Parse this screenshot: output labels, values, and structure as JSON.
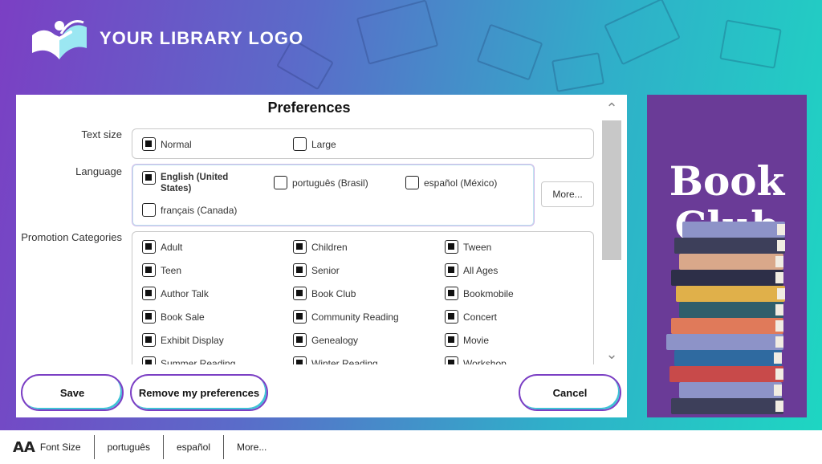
{
  "logo": {
    "text": "YOUR LIBRARY LOGO"
  },
  "dialog": {
    "title": "Preferences",
    "text_size": {
      "label": "Text size",
      "options": [
        {
          "label": "Normal",
          "checked": true
        },
        {
          "label": "Large",
          "checked": false
        }
      ]
    },
    "language": {
      "label": "Language",
      "options": [
        {
          "label": "English (United States)",
          "checked": true
        },
        {
          "label": "português (Brasil)",
          "checked": false
        },
        {
          "label": "español (México)",
          "checked": false
        },
        {
          "label": "français (Canada)",
          "checked": false
        }
      ],
      "more_label": "More..."
    },
    "promotion": {
      "label": "Promotion Categories",
      "options": [
        {
          "label": "Adult",
          "checked": true
        },
        {
          "label": "Children",
          "checked": true
        },
        {
          "label": "Tween",
          "checked": true
        },
        {
          "label": "Teen",
          "checked": true
        },
        {
          "label": "Senior",
          "checked": true
        },
        {
          "label": "All Ages",
          "checked": true
        },
        {
          "label": "Author Talk",
          "checked": true
        },
        {
          "label": "Book Club",
          "checked": true
        },
        {
          "label": "Bookmobile",
          "checked": true
        },
        {
          "label": "Book Sale",
          "checked": true
        },
        {
          "label": "Community Reading",
          "checked": true
        },
        {
          "label": "Concert",
          "checked": true
        },
        {
          "label": "Exhibit Display",
          "checked": true
        },
        {
          "label": "Genealogy",
          "checked": true
        },
        {
          "label": "Movie",
          "checked": true
        },
        {
          "label": "Summer Reading",
          "checked": true
        },
        {
          "label": "Winter Reading",
          "checked": true
        },
        {
          "label": "Workshop",
          "checked": true
        }
      ]
    },
    "buttons": {
      "save": "Save",
      "remove": "Remove my preferences",
      "cancel": "Cancel"
    }
  },
  "promo_panel": {
    "title_line1": "Book",
    "title_line2": "Club"
  },
  "bottom_bar": {
    "font_size": "Font Size",
    "font_icon": "AA",
    "items": [
      "português",
      "español",
      "More..."
    ]
  },
  "colors": {
    "purple": "#7b3fc4",
    "teal": "#1ed6c2",
    "promo_bg": "#6a3b97"
  },
  "icons": [
    "library-logo-icon",
    "checkbox-icon",
    "scroll-up-icon",
    "scroll-down-icon",
    "font-size-icon"
  ]
}
